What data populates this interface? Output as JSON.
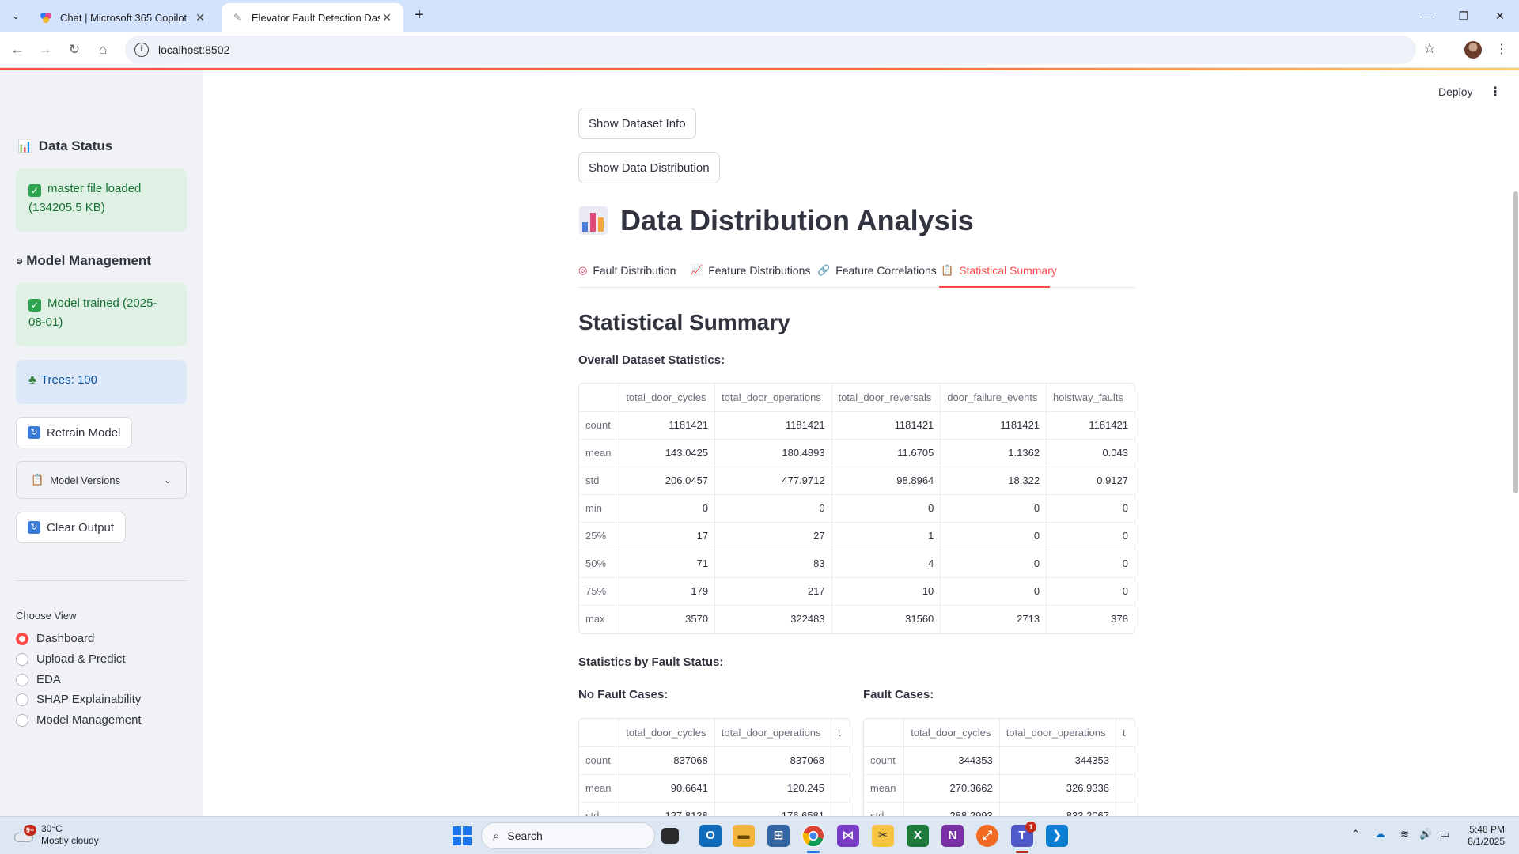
{
  "browser": {
    "tabs": [
      {
        "title": "Chat | Microsoft 365 Copilot",
        "favicon": "copilot-icon",
        "active": false
      },
      {
        "title": "Elevator Fault Detection Dashbo",
        "favicon": "streamlit-icon",
        "active": true
      }
    ],
    "url": "localhost:8502"
  },
  "sidebar": {
    "data_status_heading": "Data Status",
    "data_status_msg": "master file loaded (134205.5 KB)",
    "model_mgmt_heading": "Model Management",
    "model_trained_msg": "Model trained (2025-08-01)",
    "trees_msg": "Trees: 100",
    "retrain_label": "Retrain Model",
    "model_versions_label": "Model Versions",
    "clear_output_label": "Clear Output",
    "choose_view_label": "Choose View",
    "views": [
      "Dashboard",
      "Upload & Predict",
      "EDA",
      "SHAP Explainability",
      "Model Management"
    ],
    "selected_view": "Dashboard"
  },
  "header": {
    "deploy_label": "Deploy"
  },
  "main": {
    "show_dataset_info": "Show Dataset Info",
    "show_data_distribution": "Show Data Distribution",
    "title": "Data Distribution Analysis",
    "tabs": [
      {
        "label": "Fault Distribution",
        "icon": "target-icon"
      },
      {
        "label": "Feature Distributions",
        "icon": "chart-increasing-icon"
      },
      {
        "label": "Feature Correlations",
        "icon": "link-icon"
      },
      {
        "label": "Statistical Summary",
        "icon": "clipboard-icon"
      }
    ],
    "active_tab": "Statistical Summary",
    "section_title": "Statistical Summary",
    "overall_label": "Overall Dataset Statistics:",
    "overall_table": {
      "columns": [
        "total_door_cycles",
        "total_door_operations",
        "total_door_reversals",
        "door_failure_events",
        "hoistway_faults"
      ],
      "rows": [
        {
          "idx": "count",
          "vals": [
            "1181421",
            "1181421",
            "1181421",
            "1181421",
            "1181421"
          ]
        },
        {
          "idx": "mean",
          "vals": [
            "143.0425",
            "180.4893",
            "11.6705",
            "1.1362",
            "0.043"
          ]
        },
        {
          "idx": "std",
          "vals": [
            "206.0457",
            "477.9712",
            "98.8964",
            "18.322",
            "0.9127"
          ]
        },
        {
          "idx": "min",
          "vals": [
            "0",
            "0",
            "0",
            "0",
            "0"
          ]
        },
        {
          "idx": "25%",
          "vals": [
            "17",
            "27",
            "1",
            "0",
            "0"
          ]
        },
        {
          "idx": "50%",
          "vals": [
            "71",
            "83",
            "4",
            "0",
            "0"
          ]
        },
        {
          "idx": "75%",
          "vals": [
            "179",
            "217",
            "10",
            "0",
            "0"
          ]
        },
        {
          "idx": "max",
          "vals": [
            "3570",
            "322483",
            "31560",
            "2713",
            "378"
          ]
        }
      ]
    },
    "by_fault_label": "Statistics by Fault Status:",
    "no_fault_label": "No Fault Cases:",
    "fault_label": "Fault Cases:",
    "no_fault_table": {
      "columns": [
        "total_door_cycles",
        "total_door_operations",
        "t"
      ],
      "rows": [
        {
          "idx": "count",
          "vals": [
            "837068",
            "837068"
          ]
        },
        {
          "idx": "mean",
          "vals": [
            "90.6641",
            "120.245"
          ]
        },
        {
          "idx": "std",
          "vals": [
            "127.8138",
            "176.6581"
          ]
        }
      ]
    },
    "fault_table": {
      "columns": [
        "total_door_cycles",
        "total_door_operations",
        "t"
      ],
      "rows": [
        {
          "idx": "count",
          "vals": [
            "344353",
            "344353"
          ]
        },
        {
          "idx": "mean",
          "vals": [
            "270.3662",
            "326.9336"
          ]
        },
        {
          "idx": "std",
          "vals": [
            "288.2993",
            "833.2067"
          ]
        }
      ]
    }
  },
  "taskbar": {
    "weather_temp": "30°C",
    "weather_desc": "Mostly cloudy",
    "weather_badge": "9+",
    "search_placeholder": "Search",
    "time": "5:48 PM",
    "date": "8/1/2025",
    "teams_badge": "1"
  },
  "colors": {
    "accent": "#ff4b4b",
    "success_bg": "#dff0e4",
    "info_bg": "#dce8f8"
  }
}
